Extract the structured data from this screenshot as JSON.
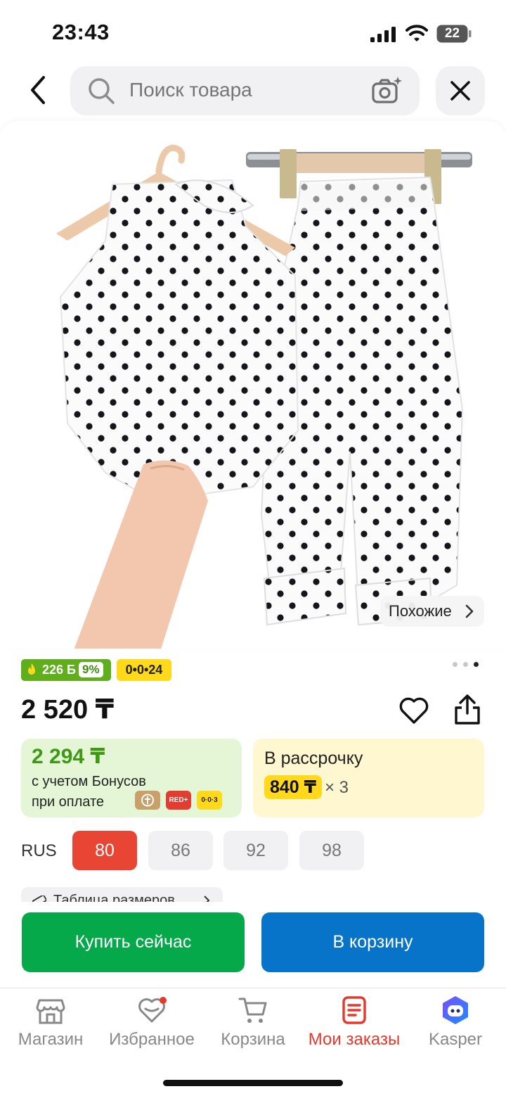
{
  "status_bar": {
    "time": "23:43",
    "battery": "22"
  },
  "search": {
    "placeholder": "Поиск товара"
  },
  "product": {
    "similar_label": "Похожие",
    "badge_points": "226 Б",
    "badge_percent": "9%",
    "badge_installment": "0•0•24",
    "price": "2 520 ₸",
    "image_page": {
      "current": 3,
      "total": 3
    }
  },
  "bonus_card": {
    "amount": "2 294 ₸",
    "line1": "с учетом Бонусов",
    "line2": "при оплате",
    "pay_red": "RED+",
    "pay_yellow": "0·0·3"
  },
  "installment_card": {
    "title": "В рассрочку",
    "amount": "840 ₸",
    "multiplier": "× 3"
  },
  "sizes": {
    "system": "RUS",
    "options": [
      "80",
      "86",
      "92",
      "98"
    ],
    "selected": "80",
    "table_label": "Таблица размеров"
  },
  "actions": {
    "buy_now": "Купить сейчас",
    "add_to_cart": "В корзину"
  },
  "tab_bar": {
    "items": [
      {
        "label": "Магазин",
        "icon": "shop-icon"
      },
      {
        "label": "Избранное",
        "icon": "heart-icon"
      },
      {
        "label": "Корзина",
        "icon": "cart-icon"
      },
      {
        "label": "Мои заказы",
        "icon": "orders-icon"
      },
      {
        "label": "Kasper",
        "icon": "kasper-icon"
      }
    ],
    "active": "Мои заказы"
  },
  "colors": {
    "accent_red": "#e6392c",
    "buy_green": "#06a94a",
    "cart_blue": "#0874c9",
    "yellow": "#ffd91a"
  }
}
